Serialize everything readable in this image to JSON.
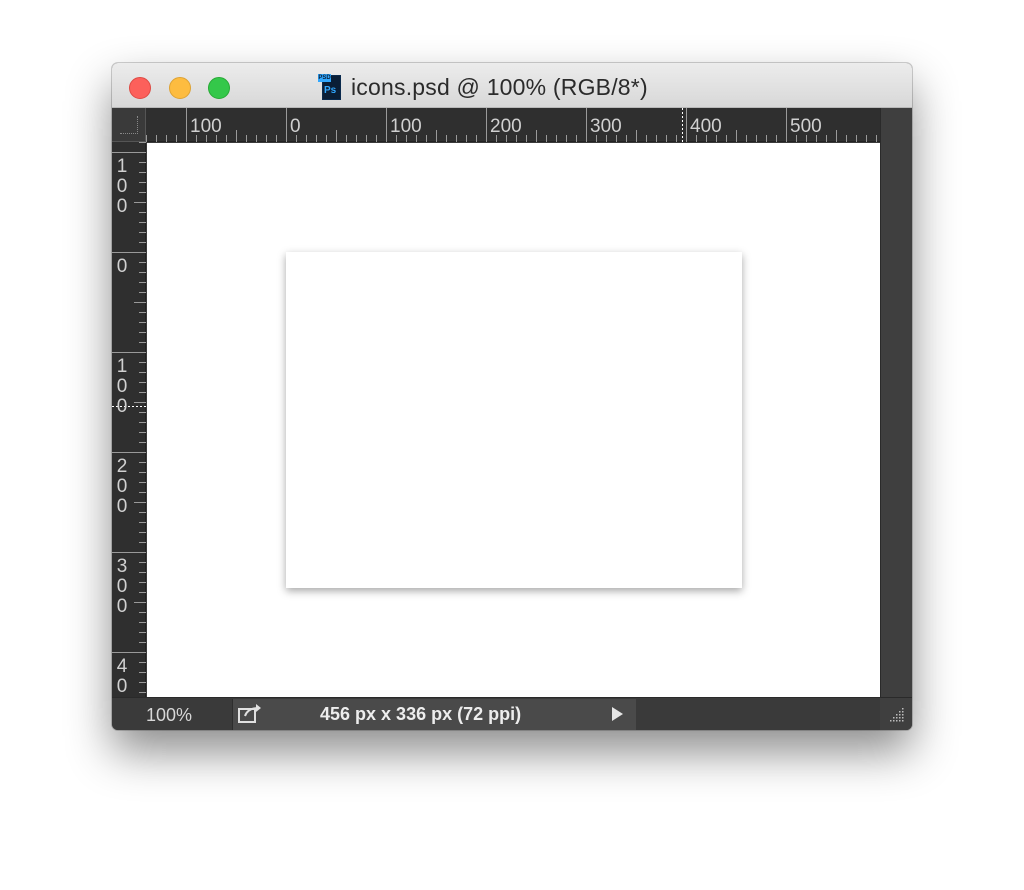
{
  "window": {
    "title": "icons.psd @ 100% (RGB/8*)",
    "file_icon_tag": "PSD",
    "file_icon_text": "Ps"
  },
  "ruler": {
    "horizontal_labels": [
      "100",
      "0",
      "100",
      "200",
      "300",
      "400",
      "500"
    ],
    "vertical_labels": [
      "100",
      "0",
      "100",
      "200",
      "300",
      "40"
    ]
  },
  "status": {
    "zoom": "100%",
    "doc_info": "456 px x 336 px (72 ppi)"
  },
  "icons": {
    "close": "close-traffic-light-icon",
    "minimize": "minimize-traffic-light-icon",
    "maximize": "maximize-traffic-light-icon",
    "file": "photoshop-file-icon",
    "share": "share-icon",
    "arrow": "play-triangle-icon",
    "grip": "resize-grip-icon"
  },
  "colors": {
    "close": "#fc605b",
    "minimize": "#fdbc40",
    "maximize": "#34c84a",
    "ruler_bg": "#2f2f2f",
    "chrome_bg": "#3a3a3a"
  }
}
